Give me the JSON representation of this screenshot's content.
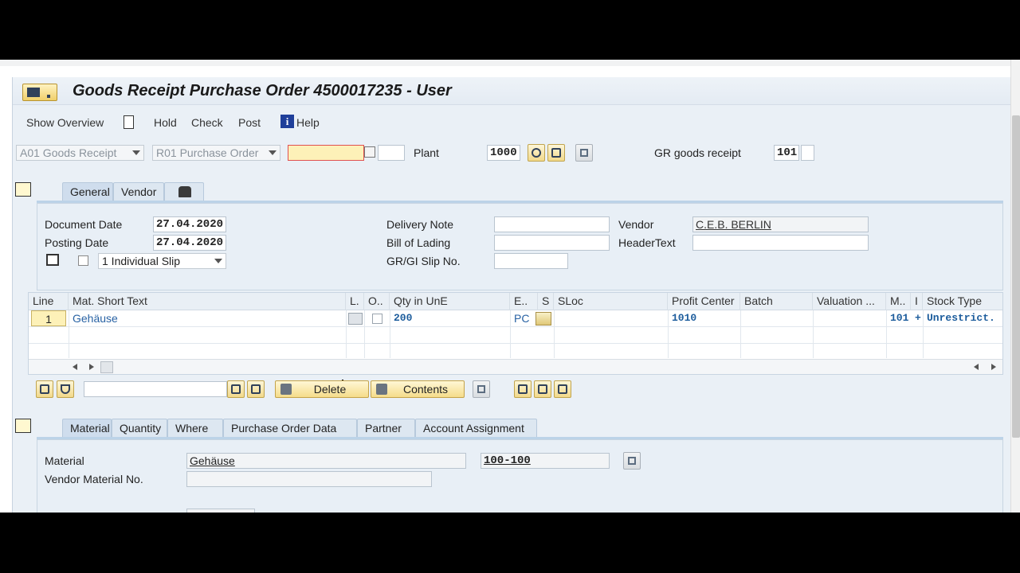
{
  "window": {
    "title": "Goods Receipt Purchase Order 4500017235 - User"
  },
  "menu": {
    "show_overview": "Show Overview",
    "hold": "Hold",
    "check": "Check",
    "post": "Post",
    "help": "Help"
  },
  "header_row": {
    "transaction_select": "A01 Goods Receipt",
    "reference_select": "R01 Purchase Order",
    "po_number_value": "",
    "plant_label": "Plant",
    "plant_value": "1000",
    "gr_label": "GR goods receipt",
    "gr_value": "101"
  },
  "header_tabs": [
    {
      "label": "General"
    },
    {
      "label": "Vendor"
    }
  ],
  "general": {
    "document_date_label": "Document Date",
    "document_date": "27.04.2020",
    "posting_date_label": "Posting Date",
    "posting_date": "27.04.2020",
    "slip_option": "1 Individual Slip",
    "delivery_note_label": "Delivery Note",
    "delivery_note": "",
    "bill_of_lading_label": "Bill of Lading",
    "bill_of_lading": "",
    "gr_gi_slip_label": "GR/GI Slip No.",
    "gr_gi_slip": "",
    "vendor_label": "Vendor",
    "vendor": "C.E.B. BERLIN",
    "header_text_label": "HeaderText",
    "header_text": ""
  },
  "items_table": {
    "columns": [
      "Line",
      "Mat. Short Text",
      "L.",
      "O..",
      "Qty in UnE",
      "E..",
      "S",
      "SLoc",
      "Profit Center",
      "Batch",
      "Valuation ...",
      "M..",
      "I",
      "Stock Type"
    ],
    "rows": [
      {
        "line": "1",
        "mat_short_text": "Gehäuse",
        "qty": "200",
        "unit": "PC",
        "sloc": "",
        "profit_center": "1010",
        "batch": "",
        "valuation": "",
        "movement": "101",
        "indicator": "+",
        "stock_type": "Unrestrict."
      }
    ]
  },
  "table_toolbar": {
    "delete_label": "Delete",
    "contents_label": "Contents",
    "search_value": ""
  },
  "item_tabs": [
    {
      "label": "Material"
    },
    {
      "label": "Quantity"
    },
    {
      "label": "Where"
    },
    {
      "label": "Purchase Order Data"
    },
    {
      "label": "Partner"
    },
    {
      "label": "Account Assignment"
    }
  ],
  "material_detail": {
    "material_label": "Material",
    "material_text": "Gehäuse",
    "material_number": "100-100",
    "vendor_material_label": "Vendor Material No.",
    "vendor_material": ""
  },
  "colors": {
    "accent_yellow": "#f5dc8a",
    "link_blue": "#1c5c9c",
    "panel_bg": "#eaf0f6"
  }
}
